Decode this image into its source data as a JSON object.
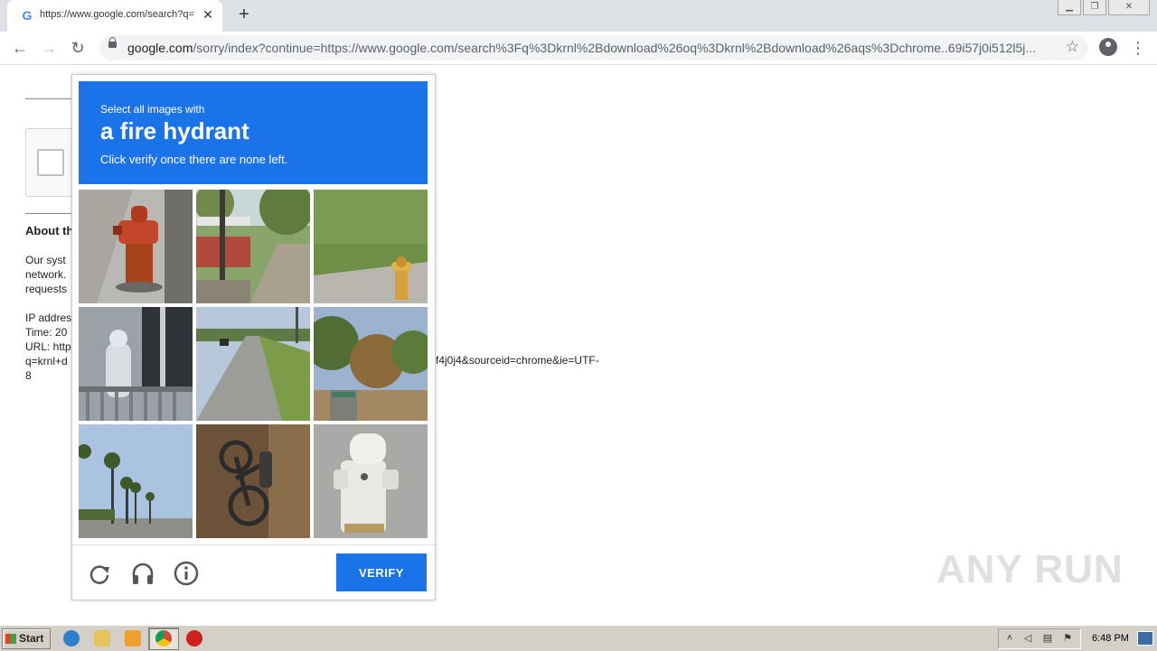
{
  "browser": {
    "tab": {
      "title": "https://www.google.com/search?q=",
      "favicon": "G"
    },
    "url": {
      "host": "google.com",
      "path": "/sorry/index?continue=https://www.google.com/search%3Fq%3Dkrnl%2Bdownload%26oq%3Dkrnl%2Bdownload%26aqs%3Dchrome..69i57j0i512l5j..."
    },
    "icons": {
      "back": "←",
      "forward": "→",
      "reload": "↻",
      "star": "☆",
      "menu": "⋮",
      "new_tab": "+",
      "close": "✕"
    }
  },
  "page": {
    "about_title": "About th",
    "paragraph": [
      "Our syst",
      "network.",
      "requests"
    ],
    "info": [
      "IP addres",
      "Time: 20",
      "URL: http",
      "q=krnl+d",
      "8"
    ],
    "url_tail": "f4j0j4&sourceid=chrome&ie=UTF-"
  },
  "captcha": {
    "subtitle": "Select all images with",
    "target": "a fire hydrant",
    "instruction": "Click verify once there are none left.",
    "verify_label": "VERIFY",
    "colors": {
      "accent": "#1a73e8"
    }
  },
  "watermark": "ANY RUN",
  "taskbar": {
    "start_label": "Start",
    "clock": "6:48 PM"
  }
}
